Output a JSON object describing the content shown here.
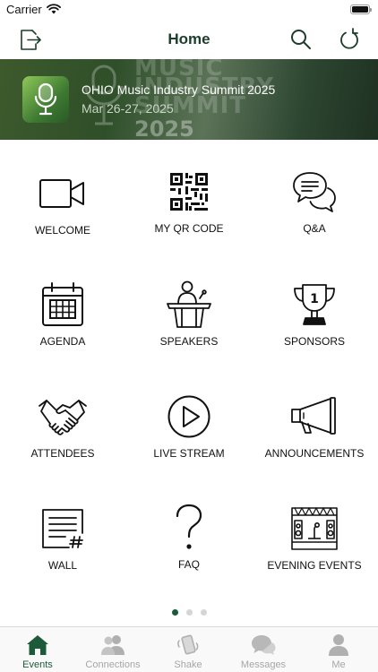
{
  "status_bar": {
    "carrier": "Carrier",
    "wifi_icon": "wifi-icon",
    "battery_icon": "battery-icon"
  },
  "nav": {
    "title": "Home",
    "left_icon": "logout-icon",
    "right_icons": [
      "search-icon",
      "refresh-icon"
    ],
    "title_color": "#1c3d2a"
  },
  "banner": {
    "title": "OHIO Music Industry Summit 2025",
    "date": "Mar 26-27, 2025",
    "logo_icon": "microphone-logo-icon",
    "background_lines": [
      "MUSIC",
      "INDUSTRY",
      "SUMMIT"
    ],
    "background_year": "2025"
  },
  "grid": {
    "items": [
      {
        "label": "WELCOME",
        "icon": "video-camera-icon"
      },
      {
        "label": "MY QR CODE",
        "icon": "qr-code-icon"
      },
      {
        "label": "Q&A",
        "icon": "chat-bubbles-icon"
      },
      {
        "label": "AGENDA",
        "icon": "calendar-icon"
      },
      {
        "label": "SPEAKERS",
        "icon": "speaker-podium-icon"
      },
      {
        "label": "SPONSORS",
        "icon": "trophy-icon"
      },
      {
        "label": "ATTENDEES",
        "icon": "handshake-icon"
      },
      {
        "label": "LIVE STREAM",
        "icon": "play-circle-icon"
      },
      {
        "label": "ANNOUNCEMENTS",
        "icon": "megaphone-icon"
      },
      {
        "label": "WALL",
        "icon": "wall-post-icon"
      },
      {
        "label": "FAQ",
        "icon": "question-mark-icon"
      },
      {
        "label": "EVENING EVENTS",
        "icon": "stage-icon"
      }
    ]
  },
  "pagination": {
    "pages": 3,
    "current_page": 1
  },
  "tab_bar": {
    "accent_color": "#1c5a3a",
    "inactive_color": "#a6a6a6",
    "tabs": [
      {
        "label": "Events",
        "icon": "house-icon",
        "active": true
      },
      {
        "label": "Connections",
        "icon": "people-icon",
        "active": false
      },
      {
        "label": "Shake",
        "icon": "shake-phone-icon",
        "active": false
      },
      {
        "label": "Messages",
        "icon": "messages-icon",
        "active": false
      },
      {
        "label": "Me",
        "icon": "person-icon",
        "active": false
      }
    ]
  }
}
